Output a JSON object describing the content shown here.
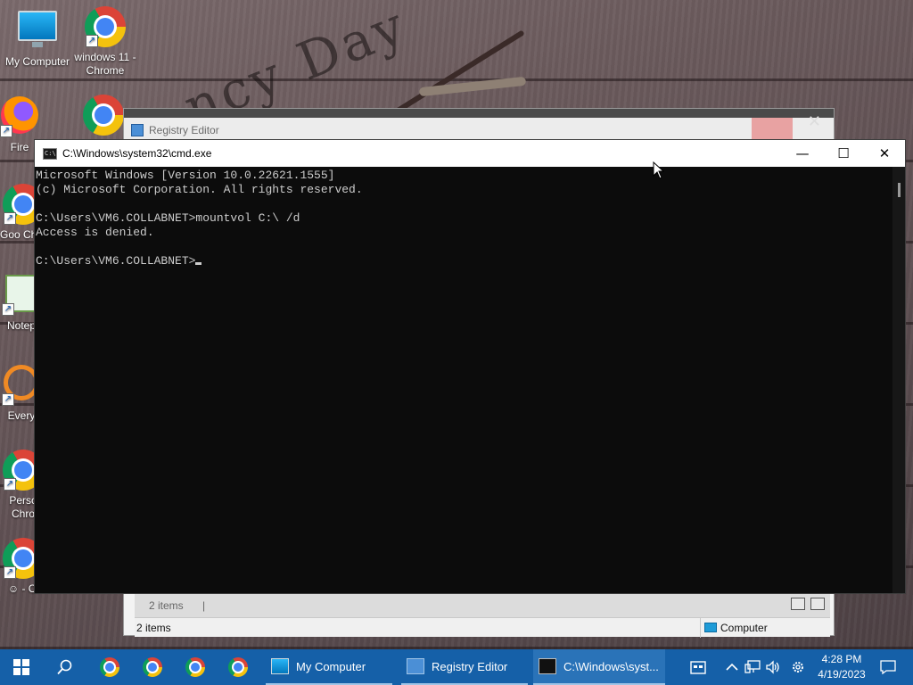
{
  "desktop": {
    "icons": [
      {
        "label": "My Computer"
      },
      {
        "label": "windows 11 - Chrome"
      },
      {
        "label": "Fire"
      },
      {
        "label": "Goo Chro"
      },
      {
        "label": "Notep"
      },
      {
        "label": "Every"
      },
      {
        "label": "Perso Chro"
      },
      {
        "label": "☺ - Cl"
      }
    ]
  },
  "regedit": {
    "title": "Registry Editor",
    "status_items": "2 items",
    "status_items2": "2 items",
    "status_computer": "Computer"
  },
  "cmd": {
    "title": "C:\\Windows\\system32\\cmd.exe",
    "lines": [
      "Microsoft Windows [Version 10.0.22621.1555]",
      "(c) Microsoft Corporation. All rights reserved.",
      "",
      "C:\\Users\\VM6.COLLABNET>mountvol C:\\ /d",
      "Access is denied.",
      "",
      "C:\\Users\\VM6.COLLABNET>"
    ],
    "minimize": "—",
    "maximize": "☐",
    "close": "✕"
  },
  "taskbar": {
    "apps": [
      {
        "label": "My Computer"
      },
      {
        "label": "Registry Editor"
      },
      {
        "label": "C:\\Windows\\syst..."
      }
    ],
    "time": "4:28 PM",
    "date": "4/19/2023"
  },
  "colors": {
    "taskbar_bg": "#1560a8",
    "console_bg": "#0c0c0c",
    "console_fg": "#cccccc"
  }
}
